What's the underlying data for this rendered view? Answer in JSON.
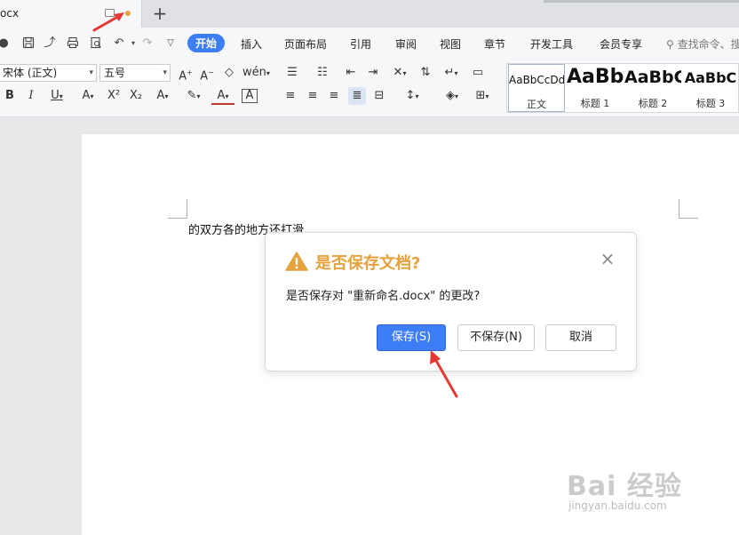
{
  "tab": {
    "title": "ocx"
  },
  "menu": {
    "items": [
      "开始",
      "插入",
      "页面布局",
      "引用",
      "审阅",
      "视图",
      "章节",
      "开发工具",
      "会员专享"
    ],
    "search_placeholder": "查找命令、搜"
  },
  "toolbar": {
    "font_name": "宋体 (正文)",
    "font_size": "五号",
    "styles": [
      {
        "sample": "AaBbCcDd",
        "name": "正文"
      },
      {
        "sample": "AaBb",
        "name": "标题 1"
      },
      {
        "sample": "AaBbC",
        "name": "标题 2"
      },
      {
        "sample": "AaBbC",
        "name": "标题 3"
      }
    ]
  },
  "document": {
    "text": "的双方各的地方还打滑"
  },
  "dialog": {
    "title": "是否保存文档?",
    "message": "是否保存对 \"重新命名.docx\" 的更改?",
    "save_label": "保存(S)",
    "dont_save_label": "不保存(N)",
    "cancel_label": "取消"
  },
  "watermark": {
    "brand": "Bai 经验",
    "url": "jingyan.baidu.com"
  },
  "colors": {
    "accent": "#3d7df6",
    "warning": "#e6a23c",
    "annotation": "#e53935"
  }
}
